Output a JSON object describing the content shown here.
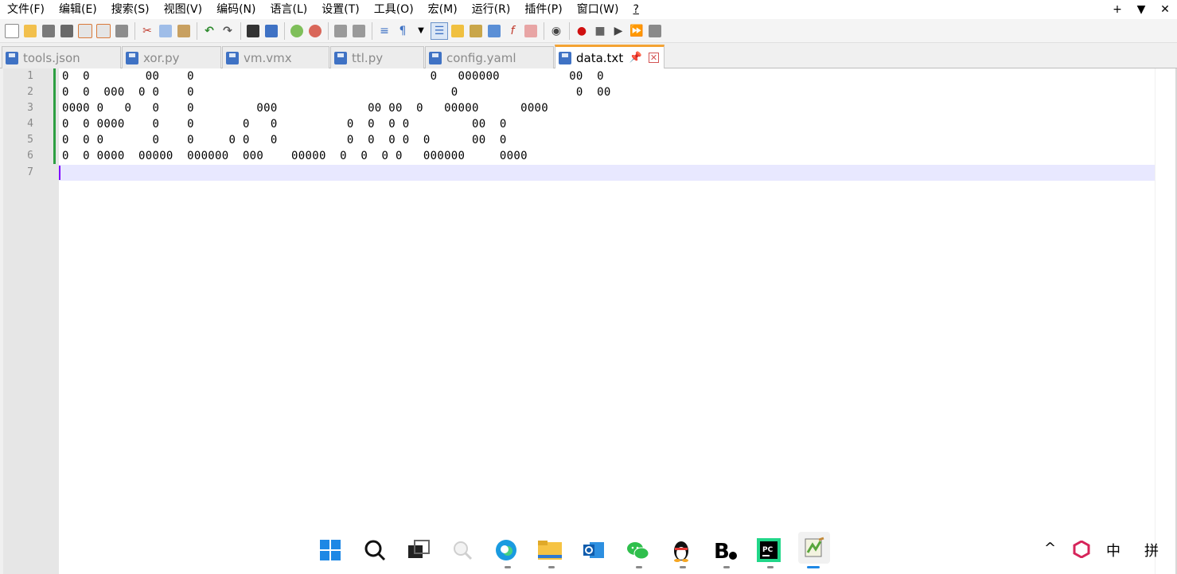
{
  "menu": [
    "文件(F)",
    "编辑(E)",
    "搜索(S)",
    "视图(V)",
    "编码(N)",
    "语言(L)",
    "设置(T)",
    "工具(O)",
    "宏(M)",
    "运行(R)",
    "插件(P)",
    "窗口(W)",
    "?"
  ],
  "menu_right": {
    "plus": "+",
    "dropdown": "▼",
    "close": "✕"
  },
  "tabs": [
    {
      "label": "tools.json"
    },
    {
      "label": "xor.py"
    },
    {
      "label": "vm.vmx"
    },
    {
      "label": "ttl.py"
    },
    {
      "label": "config.yaml"
    },
    {
      "label": "data.txt",
      "pin": "📌",
      "close": "✕"
    }
  ],
  "editor": {
    "line_numbers": [
      "1",
      "2",
      "3",
      "4",
      "5",
      "6",
      "7"
    ],
    "lines": [
      "0  0        00    0                                  0   000000          00  0",
      "0  0  000  0 0    0                                     0                 0  00",
      "0000 0   0   0    0         000             00 00  0   00000      0000",
      "0  0 0000    0    0       0   0          0  0  0 0         00  0",
      "0  0 0       0    0     0 0   0          0  0  0 0  0      00  0",
      "0  0 0000  00000  000000  000    00000  0  0  0 0   000000     0000",
      ""
    ]
  },
  "taskbar": {
    "tray_chevron": "^",
    "ime_lang": "中",
    "ime_mode": "拼"
  }
}
